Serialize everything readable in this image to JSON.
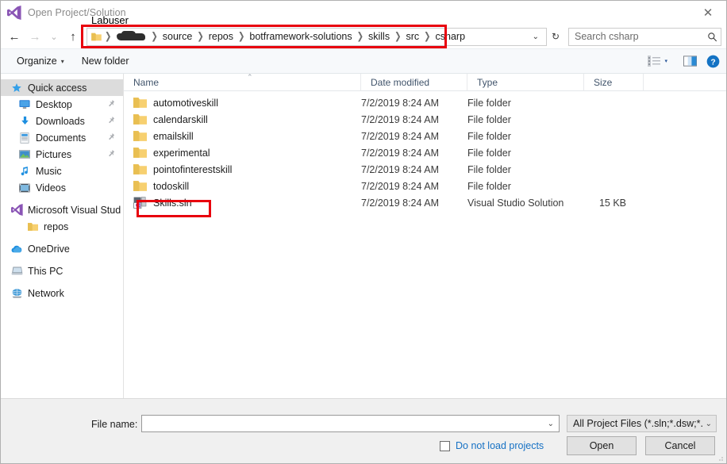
{
  "window": {
    "title": "Open Project/Solution",
    "app_icon": "visual-studio-icon",
    "close_label": "✕"
  },
  "navigation": {
    "back_icon": "←",
    "forward_icon": "→",
    "recent_icon": "⌄",
    "up_icon": "↑",
    "breadcrumbs": [
      {
        "label": "",
        "type": "folder-icon"
      },
      {
        "label": "",
        "type": "redacted"
      },
      {
        "label": "source",
        "type": "text"
      },
      {
        "label": "repos",
        "type": "text"
      },
      {
        "label": "botframework-solutions",
        "type": "text"
      },
      {
        "label": "skills",
        "type": "text"
      },
      {
        "label": "src",
        "type": "text"
      },
      {
        "label": "csharp",
        "type": "text"
      }
    ],
    "separator": "❯",
    "address_chevron": "⌄",
    "refresh_icon": "↻"
  },
  "search": {
    "placeholder": "Search csharp",
    "icon": "search-icon"
  },
  "command_bar": {
    "organize_label": "Organize",
    "organize_caret": "▾",
    "new_folder_label": "New folder",
    "view_caret": "▾"
  },
  "sidebar": {
    "items": [
      {
        "label": "Quick access",
        "icon": "star-icon",
        "selected": true,
        "pinned": false,
        "indent": 0
      },
      {
        "label": "Desktop",
        "icon": "desktop-icon",
        "selected": false,
        "pinned": true,
        "indent": 1
      },
      {
        "label": "Downloads",
        "icon": "download-icon",
        "selected": false,
        "pinned": true,
        "indent": 1
      },
      {
        "label": "Documents",
        "icon": "document-icon",
        "selected": false,
        "pinned": true,
        "indent": 1
      },
      {
        "label": "Pictures",
        "icon": "picture-icon",
        "selected": false,
        "pinned": true,
        "indent": 1
      },
      {
        "label": "Music",
        "icon": "music-icon",
        "selected": false,
        "pinned": false,
        "indent": 1
      },
      {
        "label": "Videos",
        "icon": "video-icon",
        "selected": false,
        "pinned": false,
        "indent": 1
      },
      {
        "label": "Microsoft Visual Stud",
        "icon": "visual-studio-icon",
        "selected": false,
        "pinned": false,
        "indent": 0
      },
      {
        "label": "repos",
        "icon": "folder-icon",
        "selected": false,
        "pinned": false,
        "indent": 2
      },
      {
        "label": "OneDrive",
        "icon": "onedrive-icon",
        "selected": false,
        "pinned": false,
        "indent": 0
      },
      {
        "label": "This PC",
        "icon": "this-pc-icon",
        "selected": false,
        "pinned": false,
        "indent": 0
      },
      {
        "label": "Network",
        "icon": "network-icon",
        "selected": false,
        "pinned": false,
        "indent": 0
      }
    ]
  },
  "file_list": {
    "columns": [
      "Name",
      "Date modified",
      "Type",
      "Size"
    ],
    "sort_caret": "⌃",
    "rows": [
      {
        "name": "automotiveskill",
        "date": "7/2/2019 8:24 AM",
        "type": "File folder",
        "size": "",
        "icon": "folder-icon"
      },
      {
        "name": "calendarskill",
        "date": "7/2/2019 8:24 AM",
        "type": "File folder",
        "size": "",
        "icon": "folder-icon"
      },
      {
        "name": "emailskill",
        "date": "7/2/2019 8:24 AM",
        "type": "File folder",
        "size": "",
        "icon": "folder-icon"
      },
      {
        "name": "experimental",
        "date": "7/2/2019 8:24 AM",
        "type": "File folder",
        "size": "",
        "icon": "folder-icon"
      },
      {
        "name": "pointofinterestskill",
        "date": "7/2/2019 8:24 AM",
        "type": "File folder",
        "size": "",
        "icon": "folder-icon"
      },
      {
        "name": "todoskill",
        "date": "7/2/2019 8:24 AM",
        "type": "File folder",
        "size": "",
        "icon": "folder-icon"
      },
      {
        "name": "Skills.sln",
        "date": "7/2/2019 8:24 AM",
        "type": "Visual Studio Solution",
        "size": "15 KB",
        "icon": "solution-icon"
      }
    ]
  },
  "footer": {
    "file_name_label": "File name:",
    "file_name_value": "",
    "file_name_chevron": "⌄",
    "filter_value": "All Project Files (*.sln;*.dsw;*.vcv",
    "filter_chevron": "⌄",
    "do_not_load_label": "Do not load projects",
    "do_not_load_checked": false,
    "open_label": "Open",
    "cancel_label": "Cancel"
  },
  "annotations": {
    "label": "Labuser",
    "color": "#e8000d",
    "boxes": [
      "address-bar",
      "skills-sln-row"
    ]
  }
}
